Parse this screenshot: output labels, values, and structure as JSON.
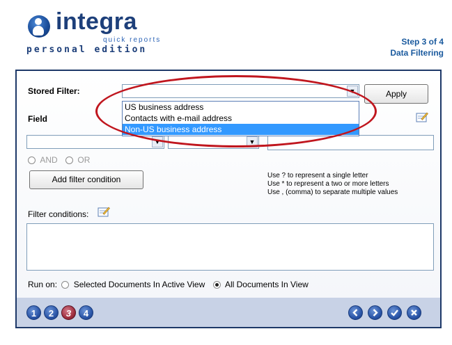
{
  "header": {
    "brand": "integra",
    "brand_sub": "quick reports",
    "edition": "personal edition",
    "step": "Step 3 of 4",
    "step_title": "Data Filtering"
  },
  "stored_filter": {
    "label": "Stored Filter:",
    "value": "",
    "apply_label": "Apply",
    "options": [
      "US business address",
      "Contacts with e-mail address",
      "Non-US business address"
    ],
    "selected_option": "Non-US business address"
  },
  "field": {
    "label": "Field",
    "field_value": "",
    "operator_value": "",
    "value_value": ""
  },
  "logic": {
    "and_label": "AND",
    "or_label": "OR"
  },
  "add_condition_label": "Add filter condition",
  "hints": [
    "Use ? to represent a single letter",
    "Use * to represent a two or more letters",
    "Use , (comma) to separate multiple values"
  ],
  "filter_conditions": {
    "label": "Filter conditions:",
    "value": ""
  },
  "run_on": {
    "label": "Run on:",
    "option1": "Selected Documents In Active View",
    "option2": "All Documents In View",
    "selected": "All Documents In View"
  },
  "nav": {
    "steps": [
      "1",
      "2",
      "3",
      "4"
    ],
    "current_step": "3",
    "controls": [
      "back-icon",
      "next-icon",
      "finish-icon",
      "cancel-icon"
    ]
  },
  "colors": {
    "accent": "#1d3868",
    "highlight": "#3399ff",
    "annotation": "#c0161e"
  }
}
